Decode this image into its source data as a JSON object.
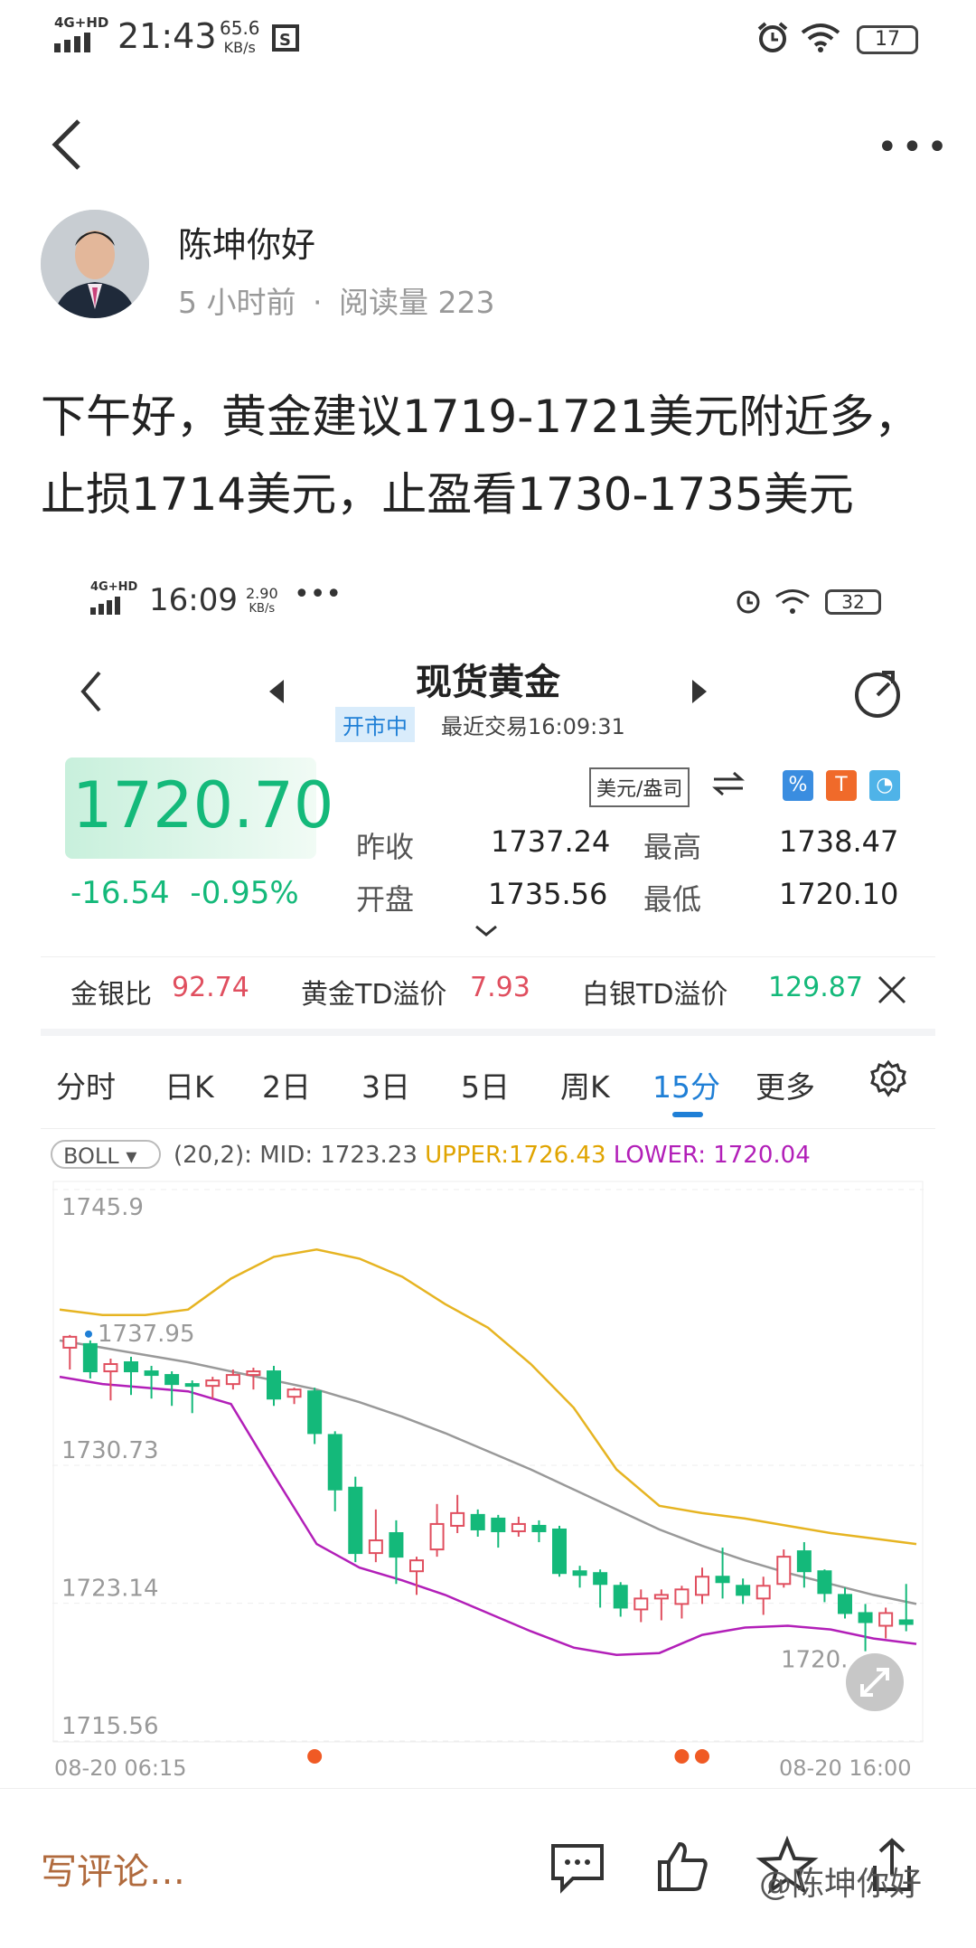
{
  "status_bar": {
    "network": "4G+HD",
    "time": "21:43",
    "speed_value": "65.6",
    "speed_unit": "KB/s",
    "battery": "17"
  },
  "post": {
    "author": "陈坤你好",
    "time_ago": "5 小时前",
    "separator": "·",
    "read_label": "阅读量",
    "read_count": "223",
    "text_line1": "下午好，黄金建议1719-1721美元附近多，",
    "text_line2": "止损1714美元，止盈看1730-1735美元"
  },
  "inner_screen": {
    "status": {
      "network": "4G+HD",
      "time": "16:09",
      "speed_value": "2.90",
      "speed_unit": "KB/s",
      "more": "•••",
      "battery": "32"
    },
    "title": "现货黄金",
    "market_status": "开市中",
    "last_trade": "最近交易16:09:31",
    "price": "1720.70",
    "change": "-16.54",
    "change_pct": "-0.95%",
    "unit": "美元/盎司",
    "quotes": {
      "prev_close_label": "昨收",
      "prev_close": "1737.24",
      "high_label": "最高",
      "high": "1738.47",
      "open_label": "开盘",
      "open": "1735.56",
      "low_label": "最低",
      "low": "1720.10"
    },
    "ratios": {
      "gold_silver_label": "金银比",
      "gold_silver": "92.74",
      "gold_td_label": "黄金TD溢价",
      "gold_td": "7.93",
      "silver_td_label": "白银TD溢价",
      "silver_td": "129.87"
    },
    "tabs": [
      "分时",
      "日K",
      "2日",
      "3日",
      "5日",
      "周K",
      "15分",
      "更多"
    ],
    "active_tab": "15分",
    "indicator": {
      "name": "BOLL",
      "params": "(20,2):",
      "mid": "MID: 1723.23",
      "upper": "UPPER:1726.43",
      "lower": "LOWER: 1720.04"
    },
    "colors": {
      "up": "#e04f5f",
      "down": "#14b97a",
      "upper": "#e6b422",
      "lower": "#b21fb8",
      "mid": "#999999",
      "accent": "#1f7fd6"
    }
  },
  "chart_data": {
    "type": "candlestick",
    "y_ticks": [
      "1745.9",
      "1730.73",
      "1723.14",
      "1715.56"
    ],
    "ylim": [
      1715.56,
      1745.9
    ],
    "y_tick_values": [
      1745.9,
      1730.73,
      1723.14,
      1715.56
    ],
    "high_marker": "1737.95",
    "low_marker": "1720.",
    "x_start": "08-20 06:15",
    "x_end": "08-20 16:00",
    "candles": [
      [
        1737.2,
        1737.8,
        1736.0,
        1737.9
      ],
      [
        1737.4,
        1735.9,
        1735.5,
        1737.6
      ],
      [
        1735.9,
        1736.3,
        1734.3,
        1736.6
      ],
      [
        1736.4,
        1735.9,
        1734.6,
        1736.7
      ],
      [
        1735.9,
        1735.7,
        1734.4,
        1736.2
      ],
      [
        1735.7,
        1735.2,
        1734.0,
        1735.9
      ],
      [
        1735.2,
        1735.1,
        1733.6,
        1735.4
      ],
      [
        1735.1,
        1735.4,
        1734.4,
        1735.6
      ],
      [
        1735.2,
        1735.7,
        1734.9,
        1736.0
      ],
      [
        1735.7,
        1735.9,
        1734.9,
        1736.1
      ],
      [
        1735.9,
        1734.4,
        1734.0,
        1736.2
      ],
      [
        1734.5,
        1734.9,
        1734.1,
        1735.0
      ],
      [
        1734.8,
        1732.5,
        1731.9,
        1735.0
      ],
      [
        1732.4,
        1729.4,
        1728.2,
        1732.6
      ],
      [
        1729.5,
        1725.9,
        1725.4,
        1730.1
      ],
      [
        1725.9,
        1726.6,
        1725.4,
        1728.3
      ],
      [
        1727.0,
        1725.7,
        1724.2,
        1727.7
      ],
      [
        1724.9,
        1725.5,
        1723.6,
        1725.7
      ],
      [
        1726.1,
        1727.5,
        1725.7,
        1728.6
      ],
      [
        1727.4,
        1728.1,
        1727.0,
        1729.1
      ],
      [
        1728.0,
        1727.2,
        1726.8,
        1728.3
      ],
      [
        1727.8,
        1727.1,
        1726.2,
        1728.0
      ],
      [
        1727.1,
        1727.5,
        1726.8,
        1727.9
      ],
      [
        1727.4,
        1727.1,
        1726.5,
        1727.7
      ],
      [
        1727.2,
        1724.8,
        1724.6,
        1727.4
      ],
      [
        1724.9,
        1724.7,
        1724.0,
        1725.2
      ],
      [
        1724.8,
        1724.2,
        1722.9,
        1725.0
      ],
      [
        1724.1,
        1722.9,
        1722.4,
        1724.3
      ],
      [
        1722.8,
        1723.4,
        1722.1,
        1723.9
      ],
      [
        1723.4,
        1723.6,
        1722.2,
        1723.9
      ],
      [
        1723.1,
        1723.9,
        1722.3,
        1724.1
      ],
      [
        1723.6,
        1724.6,
        1723.1,
        1725.1
      ],
      [
        1724.6,
        1724.3,
        1723.4,
        1726.2
      ],
      [
        1724.1,
        1723.6,
        1723.1,
        1724.5
      ],
      [
        1723.4,
        1724.1,
        1722.5,
        1724.6
      ],
      [
        1724.2,
        1725.7,
        1724.0,
        1726.1
      ],
      [
        1726.0,
        1724.9,
        1724.0,
        1726.5
      ],
      [
        1724.9,
        1723.7,
        1723.2,
        1725.0
      ],
      [
        1723.6,
        1722.6,
        1722.3,
        1724.0
      ],
      [
        1722.6,
        1722.1,
        1720.5,
        1723.1
      ],
      [
        1721.9,
        1722.6,
        1721.2,
        1722.9
      ],
      [
        1722.2,
        1722.0,
        1721.6,
        1724.2
      ]
    ],
    "mid_series": [
      1737.6,
      1737.2,
      1736.8,
      1736.4,
      1735.9,
      1735.4,
      1734.9,
      1734.2,
      1733.4,
      1732.5,
      1731.5,
      1730.5,
      1729.4,
      1728.3,
      1727.2,
      1726.3,
      1725.5,
      1724.8,
      1724.2,
      1723.6,
      1723.1
    ],
    "upper_series": [
      1739.3,
      1739.0,
      1739.0,
      1739.3,
      1741.0,
      1742.2,
      1742.6,
      1742.1,
      1741.1,
      1739.6,
      1738.3,
      1736.3,
      1733.9,
      1730.5,
      1728.5,
      1728.1,
      1727.8,
      1727.4,
      1727.0,
      1726.7,
      1726.4
    ],
    "lower_series": [
      1735.6,
      1735.2,
      1735.0,
      1734.8,
      1734.1,
      1730.2,
      1726.4,
      1725.1,
      1724.4,
      1723.6,
      1722.6,
      1721.6,
      1720.7,
      1720.3,
      1720.4,
      1721.4,
      1721.8,
      1721.9,
      1721.7,
      1721.2,
      1720.9
    ],
    "event_dots": [
      12,
      30,
      31
    ]
  },
  "bottom": {
    "comment_placeholder": "写评论…",
    "watermark": "@陈坤你好"
  }
}
